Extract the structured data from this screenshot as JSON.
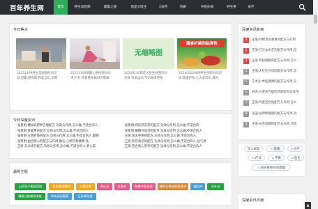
{
  "site": {
    "logo": "百年养生网"
  },
  "nav": [
    {
      "label": "首页",
      "active": true
    },
    {
      "label": "养生常视频",
      "active": false
    },
    {
      "label": "健康之路",
      "active": false
    },
    {
      "label": "我是大医生",
      "active": false
    },
    {
      "label": "X会所",
      "active": false
    },
    {
      "label": "泡脚",
      "active": false
    },
    {
      "label": "中医体质",
      "active": false
    },
    {
      "label": "养生茶",
      "active": false
    },
    {
      "label": "食疗",
      "active": false
    }
  ],
  "focus": {
    "title": "今日焦点",
    "items": [
      {
        "caption1": "20251109养生常视频时间记",
        "caption2": "录,胆囊,健身康,养虚自仇,早期",
        "image_text": ""
      },
      {
        "caption1": "20251109健康之路视频时间",
        "caption2": "记,户外,带着健身器材的健康",
        "image_text": ""
      },
      {
        "caption1": "20240530我是大医生视频时间",
        "caption2": "记录,有氧运动,不论做成更跑",
        "image_text": "无缩略图"
      },
      {
        "caption1": "20240502体质养生视频时间记",
        "caption2": "录,健康护体,七大类常体,清白",
        "image_text": "膳食纤维的粘滞性"
      }
    ]
  },
  "deep_news": {
    "title": "今日深度资讯",
    "left": [
      "· 张景明:糖尿病管种吉顺配方 功效与作用,怎么做,不适合的人",
      "· 张景明:参麦茶的配方 功效与作用,怎么做,不适合的人",
      "· 张景明:五香虾炖的配方,功效与作用,怎么做,不适合的人,健脾",
      "· 张景明:由合斯心的配方与作用,做法,小肠学和健脾,快",
      "· 王丽:东瓜炖的配方,功效与作用,怎么做,不适合的人,养心安"
    ],
    "right": [
      "· 张景明:四药芡实茶的配方,功效与作用,怎么做,不适合的",
      "· 张景明:橄糖豆豉汤的配方,功效与作用,怎么做,不适合的人",
      "· 王丽:地龙参茶的配方,功效与作用,怎么做,不适合的人,",
      "· 王丽:参芪黄芪的配方,功效与作用,怎么做,不适合的人,益气温",
      "· 王丽:百合炖心参苓的配方,功效与作用,怎么做,不适合的人"
    ]
  },
  "topics": {
    "title": "最新主题",
    "tags": [
      {
        "label": "山药莲子麦蓉菜粉",
        "color": "#27a243"
      },
      {
        "label": "吴茱萸炖猪蹄",
        "color": "#f0a91e"
      },
      {
        "label": "三黄粉煮",
        "color": "#f0a91e"
      },
      {
        "label": "黄连汤",
        "color": "#e85a87"
      },
      {
        "label": "乳腺炎",
        "color": "#e85a87"
      },
      {
        "label": "眩晕中医调理",
        "color": "#e85a87"
      },
      {
        "label": "爆鸡与陈皮粉蒸蓉汤",
        "color": "#d68a3e"
      },
      {
        "label": "益阳刘",
        "color": "#4a9fd4"
      },
      {
        "label": "五叶动",
        "color": "#27a243"
      },
      {
        "label": "健康之路视频讲座",
        "color": "#27a243"
      },
      {
        "label": "鸡肉汤配葡萄",
        "color": "#4a9fd4"
      },
      {
        "label": "玉米粥饮酒",
        "color": "#4a9fd4"
      }
    ]
  },
  "rank": {
    "title": "深度资讯新榜",
    "items": [
      {
        "num": "1",
        "text": "王丽:四物汤加葛根的配方与作用",
        "color": "#e34a4a"
      },
      {
        "num": "2",
        "text": "王丽:红豆淡水芝的配方与作用,怎",
        "color": "#e34a4a"
      },
      {
        "num": "3",
        "text": "王丽:枸杞桃酿的配方与作用,怎么",
        "color": "#e34a4a"
      },
      {
        "num": "4",
        "text": "王丽:大红红豆烧肉配方与作用,怎",
        "color": "#999999"
      },
      {
        "num": "5",
        "text": "于太仓:中医健脾的配方与作用,怎",
        "color": "#999999"
      },
      {
        "num": "6",
        "text": "林洪:沙参玉竹瘦肉汤的配方与作用",
        "color": "#999999"
      },
      {
        "num": "7",
        "text": "王丽:鸡蛋百合饭配方与作用,怎么",
        "color": "#999999"
      },
      {
        "num": "8",
        "text": "吴国:益神胖服肠的配方与作用,功",
        "color": "#999999"
      },
      {
        "num": "9",
        "text": "王丽:长杏鸡糖的配方与作用,功效",
        "color": "#999999"
      }
    ]
  },
  "tagcloud": [
    {
      "label": "深入探索",
      "icon": ""
    },
    {
      "label": "健康",
      "icon": "⊙"
    },
    {
      "label": "治疗",
      "icon": "⊙"
    },
    {
      "label": "疗法",
      "icon": "⊙"
    },
    {
      "label": "平衡",
      "icon": "⊙"
    },
    {
      "label": "医生",
      "icon": "⊙"
    },
    {
      "label": "购买维他有效健康",
      "icon": "⊙"
    }
  ],
  "rank2": {
    "title": "深度资讯月榜"
  },
  "to_top": "▲"
}
